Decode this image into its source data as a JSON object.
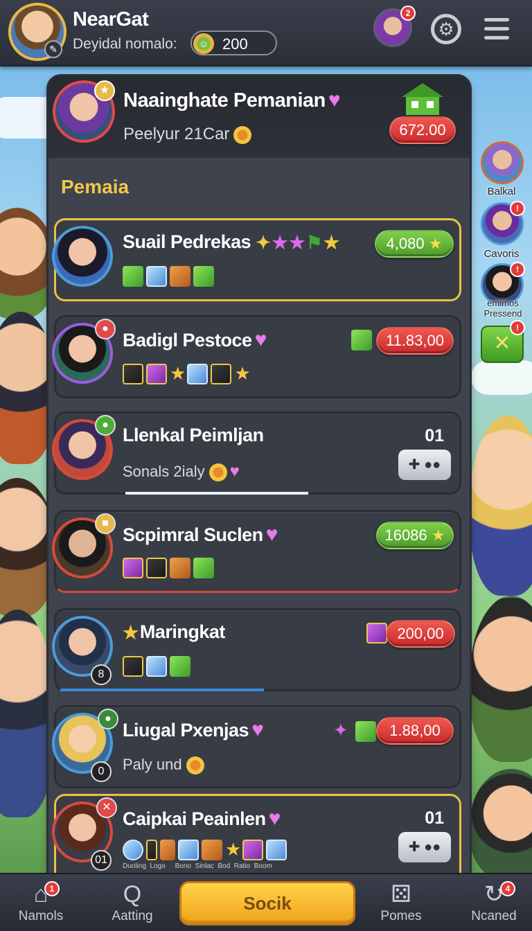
{
  "topbar": {
    "player_name": "NearGat",
    "player_sub": "Deyidal nomalo:",
    "coins": "200",
    "friend_badge": "2"
  },
  "header": {
    "title": "Naainghate Pemanian",
    "subtitle": "Peelyur 21Car",
    "value": "672.00"
  },
  "section_label": "Pemaia",
  "cards": [
    {
      "name": "Suail Pedrekas",
      "value": "4,080",
      "value_color": "green"
    },
    {
      "name": "Badigl Pestoce",
      "value": "11.83,00",
      "value_color": "red"
    },
    {
      "name": "Llenkal Peimljan",
      "sub": "Sonals 2ialy",
      "num": "01",
      "progress": 0.55
    },
    {
      "name": "Scpimral Suclen",
      "value": "16086",
      "value_color": "green"
    },
    {
      "name": "Maringkat",
      "value": "200,00",
      "value_color": "red",
      "badge": "8",
      "progress": 0.5
    },
    {
      "name": "Liugal Pxenjas",
      "sub": "Paly und",
      "value": "1.88,00",
      "value_color": "red",
      "badge": "0"
    },
    {
      "name": "Caipkai Peainlen",
      "num": "01",
      "badge": "01"
    }
  ],
  "card7_labels": [
    "Duoling",
    "Logo",
    "Bono",
    "Sinlac",
    "Bod",
    "Ratio",
    "Boom"
  ],
  "side_friends": [
    {
      "label": "Balkal"
    },
    {
      "label": "Cavoris"
    },
    {
      "label": "emimos Pressend"
    }
  ],
  "nav": {
    "home": "Namols",
    "home_badge": "1",
    "chat": "Aatting",
    "main_button": "Socik",
    "games": "Pomes",
    "new": "Ncaned",
    "new_badge": "4"
  },
  "colors": {
    "gold": "#e8c145",
    "red": "#d43a30",
    "green": "#5cb030",
    "panel": "#3f434d"
  }
}
